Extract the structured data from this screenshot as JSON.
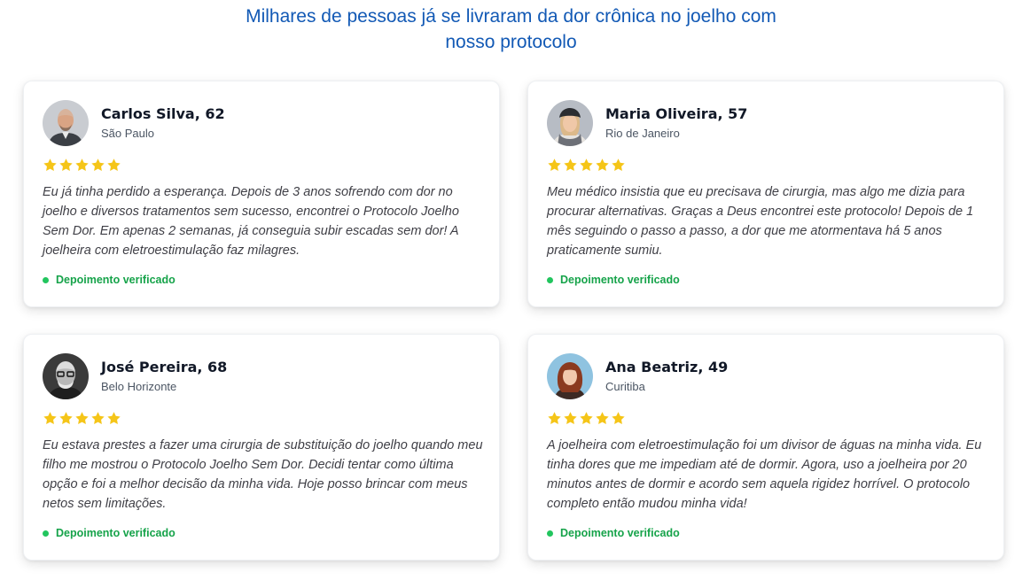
{
  "heading": {
    "line1": "Milhares de pessoas já se livraram da dor crônica no joelho com",
    "line2": "nosso protocolo"
  },
  "colors": {
    "heading": "#1259b5",
    "star": "#f5c518",
    "verified": "#16a34a"
  },
  "testimonials": [
    {
      "name": "Carlos Silva, 62",
      "city": "São Paulo",
      "rating": 5,
      "avatar_icon": "man-avatar-photo",
      "quote": "Eu já tinha perdido a esperança. Depois de 3 anos sofrendo com dor no joelho e diversos tratamentos sem sucesso, encontrei o Protocolo Joelho Sem Dor. Em apenas 2 semanas, já conseguia subir escadas sem dor! A joelheira com eletroestimulação faz milagres.",
      "verified": "Depoimento verificado"
    },
    {
      "name": "Maria Oliveira, 57",
      "city": "Rio de Janeiro",
      "rating": 5,
      "avatar_icon": "woman-avatar-photo",
      "quote": "Meu médico insistia que eu precisava de cirurgia, mas algo me dizia para procurar alternativas. Graças a Deus encontrei este protocolo! Depois de 1 mês seguindo o passo a passo, a dor que me atormentava há 5 anos praticamente sumiu.",
      "verified": "Depoimento verificado"
    },
    {
      "name": "José Pereira, 68",
      "city": "Belo Horizonte",
      "rating": 5,
      "avatar_icon": "man-avatar-photo",
      "quote": "Eu estava prestes a fazer uma cirurgia de substituição do joelho quando meu filho me mostrou o Protocolo Joelho Sem Dor. Decidi tentar como última opção e foi a melhor decisão da minha vida. Hoje posso brincar com meus netos sem limitações.",
      "verified": "Depoimento verificado"
    },
    {
      "name": "Ana Beatriz, 49",
      "city": "Curitiba",
      "rating": 5,
      "avatar_icon": "woman-avatar-photo",
      "quote": "A joelheira com eletroestimulação foi um divisor de águas na minha vida. Eu tinha dores que me impediam até de dormir. Agora, uso a joelheira por 20 minutos antes de dormir e acordo sem aquela rigidez horrível. O protocolo completo então mudou minha vida!",
      "verified": "Depoimento verificado"
    }
  ]
}
